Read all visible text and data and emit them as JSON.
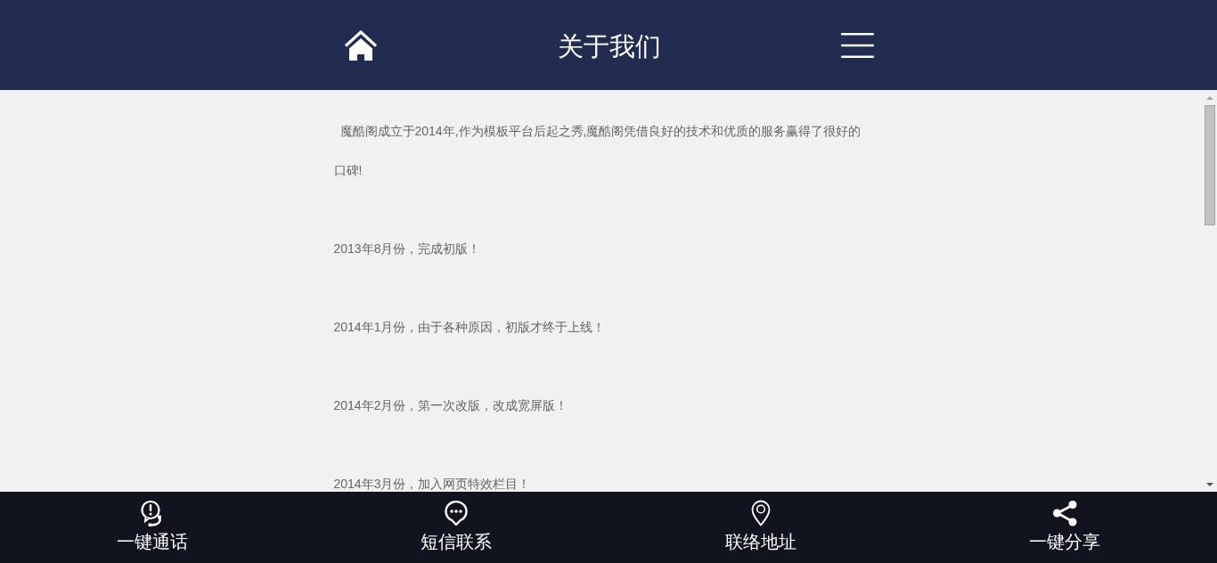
{
  "header": {
    "title": "关于我们"
  },
  "content": {
    "paragraphs": [
      "魔酷阁成立于2014年,作为模板平台后起之秀,魔酷阁凭借良好的技术和优质的服务赢得了很好的口碑!",
      "2013年8月份，完成初版！",
      "2014年1月份，由于各种原因，初版才终于上线！",
      "2014年2月份，第一次改版，改成宽屏版！",
      "2014年3月份，加入网页特效栏目！"
    ]
  },
  "bottom_nav": [
    {
      "kind": "call",
      "label": "一键通话"
    },
    {
      "kind": "sms",
      "label": "短信联系"
    },
    {
      "kind": "address",
      "label": "联络地址"
    },
    {
      "kind": "share",
      "label": "一键分享"
    }
  ]
}
